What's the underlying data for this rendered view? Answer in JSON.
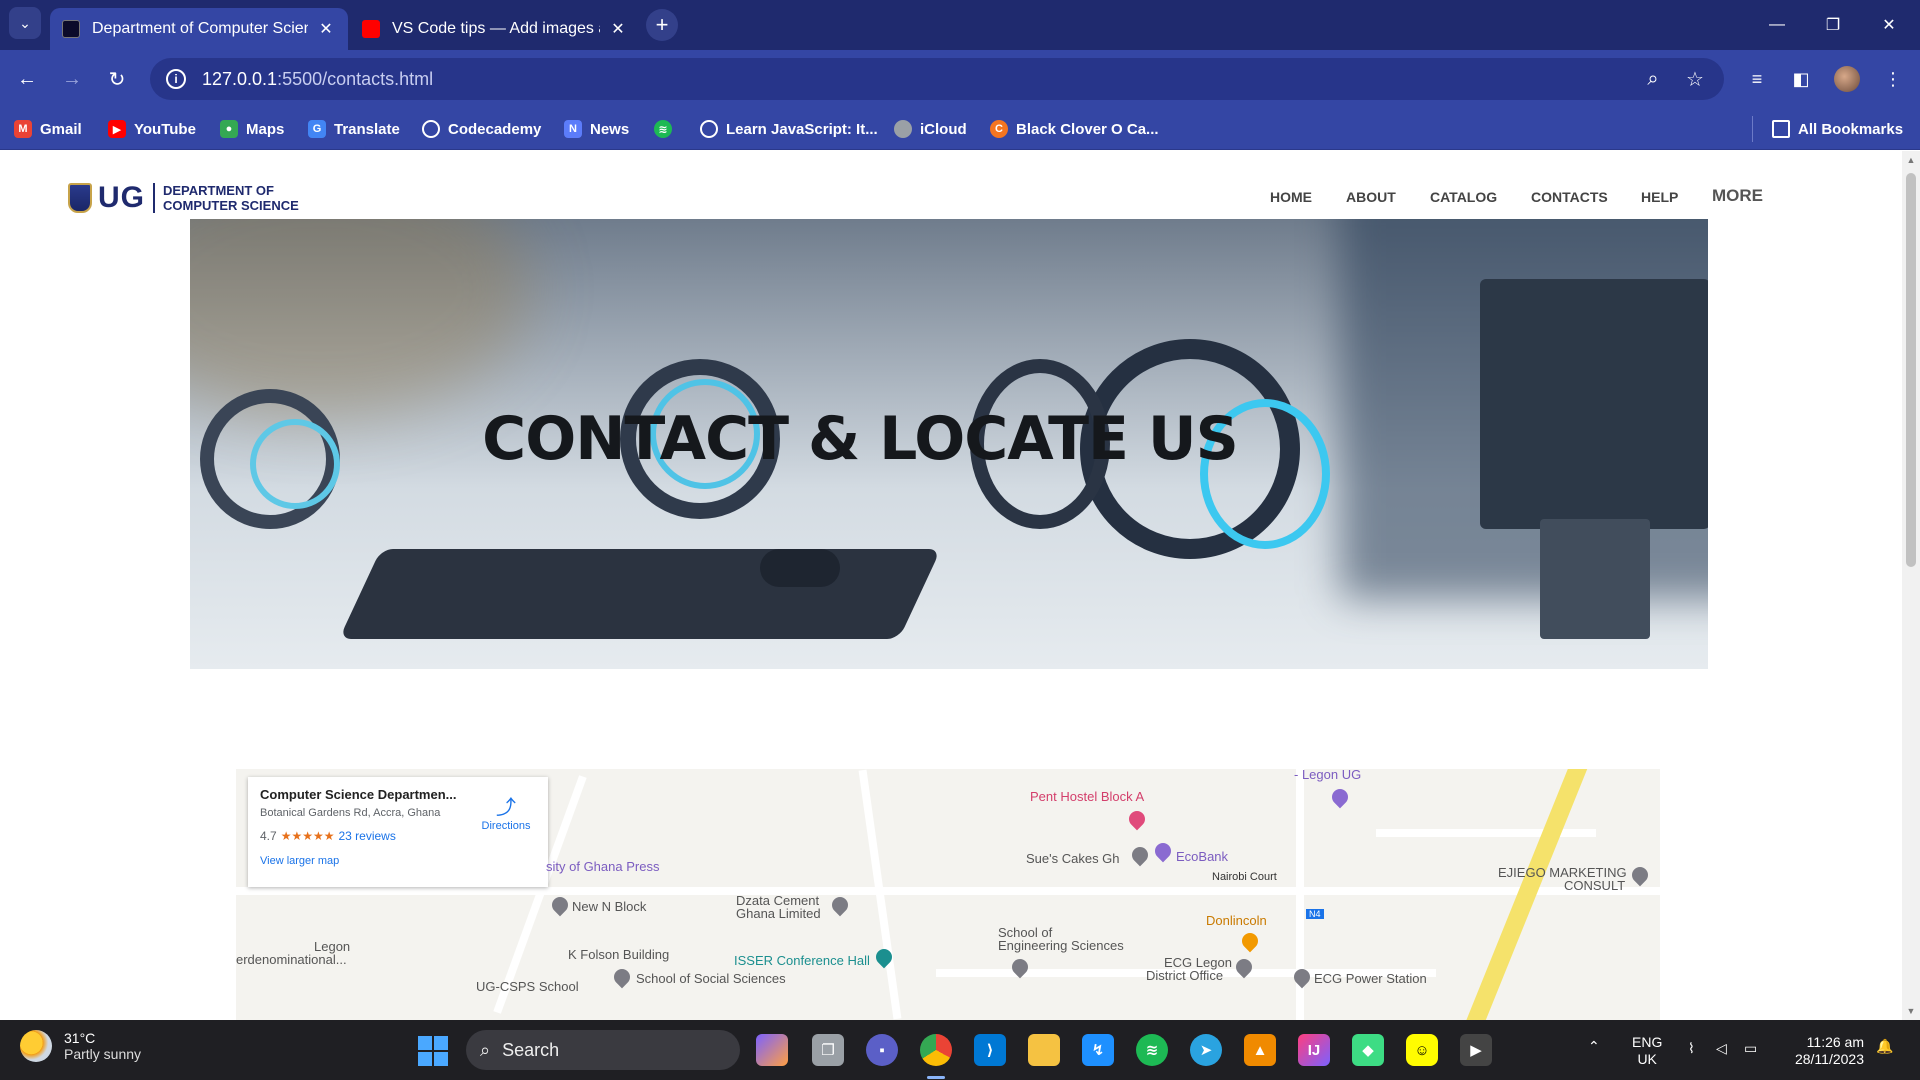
{
  "browser": {
    "tabs": [
      {
        "title": "Department of Computer Science",
        "active": true,
        "favicon_color": "#0b0b2a"
      },
      {
        "title": "VS Code tips — Add images and",
        "active": false,
        "favicon_color": "#ff0000"
      }
    ],
    "url_host": "127.0.0.1",
    "url_path": ":5500/contacts.html",
    "bookmarks": [
      {
        "label": "Gmail",
        "icon": "gmail-icon",
        "color": "#ea4335"
      },
      {
        "label": "YouTube",
        "icon": "youtube-icon",
        "color": "#ff0000"
      },
      {
        "label": "Maps",
        "icon": "maps-icon",
        "color": "#34a853"
      },
      {
        "label": "Translate",
        "icon": "translate-icon",
        "color": "#4285f4"
      },
      {
        "label": "Codecademy",
        "icon": "globe-icon",
        "color": "#3446a4"
      },
      {
        "label": "News",
        "icon": "news-icon",
        "color": "#5c7cfa"
      },
      {
        "label": "",
        "icon": "spotify-icon",
        "color": "#1db954"
      },
      {
        "label": "Learn JavaScript: It...",
        "icon": "globe-icon",
        "color": "#3446a4"
      },
      {
        "label": "iCloud",
        "icon": "apple-icon",
        "color": "#9aa0a6"
      },
      {
        "label": "Black Clover O Ca...",
        "icon": "crunchyroll-icon",
        "color": "#f47521"
      }
    ],
    "all_bookmarks": "All Bookmarks"
  },
  "site": {
    "logo_ug": "UG",
    "logo_dept_line1": "DEPARTMENT OF",
    "logo_dept_line2": "COMPUTER SCIENCE",
    "nav": [
      "HOME",
      "ABOUT",
      "CATALOG",
      "CONTACTS",
      "HELP",
      "MORE"
    ],
    "hero_title": "CONTACT & LOCATE US"
  },
  "map": {
    "card": {
      "name": "Computer Science Departmen...",
      "address": "Botanical Gardens Rd, Accra, Ghana",
      "rating": "4.7",
      "stars": "★★★★★",
      "reviews": "23 reviews",
      "larger_map": "View larger map",
      "directions": "Directions"
    },
    "labels": {
      "pent_hostel": "Pent Hostel Block A",
      "legon_ug": "- Legon UG",
      "sues_cakes": "Sue's Cakes Gh",
      "ecobank": "EcoBank",
      "nairobi": "Nairobi Court",
      "ejiego1": "EJIEGO MARKETING",
      "ejiego2": "CONSULT",
      "press": "sity of Ghana Press",
      "new_n_block": "New N Block",
      "dzata1": "Dzata Cement",
      "dzata2": "Ghana Limited",
      "donlincoln": "Donlincoln",
      "n4": "N4",
      "legon": "Legon",
      "interdenom": "erdenominational...",
      "k_folson": "K Folson Building",
      "isser": "ISSER Conference Hall",
      "school_eng1": "School of",
      "school_eng2": "Engineering Sciences",
      "ecg_legon1": "ECG Legon",
      "ecg_legon2": "District Office",
      "ug_csps": "UG-CSPS School",
      "social_sciences": "School of Social Sciences",
      "ecg_power": "ECG Power Station"
    }
  },
  "taskbar": {
    "temp": "31°C",
    "weather": "Partly sunny",
    "search": "Search",
    "lang1": "ENG",
    "lang2": "UK",
    "time": "11:26 am",
    "date": "28/11/2023"
  }
}
